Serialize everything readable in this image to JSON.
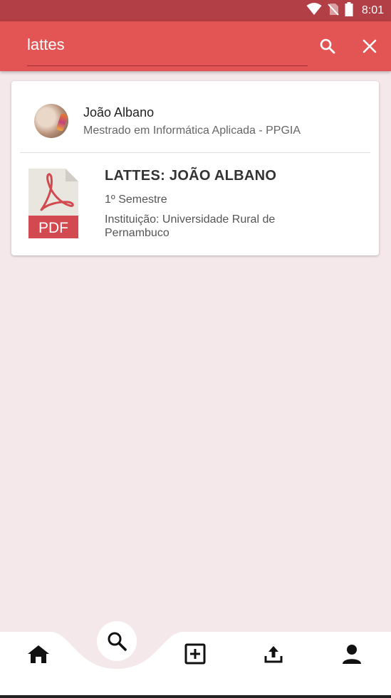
{
  "status_bar": {
    "time": "8:01",
    "icons": [
      "wifi-icon",
      "no-sim-icon",
      "battery-icon"
    ]
  },
  "search": {
    "value": "lattes",
    "icons": [
      "search-icon",
      "close-icon"
    ]
  },
  "results": {
    "user": {
      "name": "João Albano",
      "subtitle": "Mestrado em Informática Aplicada - PPGIA"
    },
    "document": {
      "icon_label": "PDF",
      "title": "LATTES: JOÃO ALBANO",
      "semester": "1º Semestre",
      "institution": "Instituição: Universidade Rural de Pernambuco"
    }
  },
  "bottom_nav": {
    "items": [
      "home-icon",
      "search-icon",
      "add-box-icon",
      "upload-icon",
      "person-icon"
    ],
    "active": "search-icon"
  },
  "colors": {
    "status_bar": "#b23f45",
    "app_bar": "#e35555",
    "background": "#f5e8ea",
    "pdf_red": "#d24a4f"
  }
}
